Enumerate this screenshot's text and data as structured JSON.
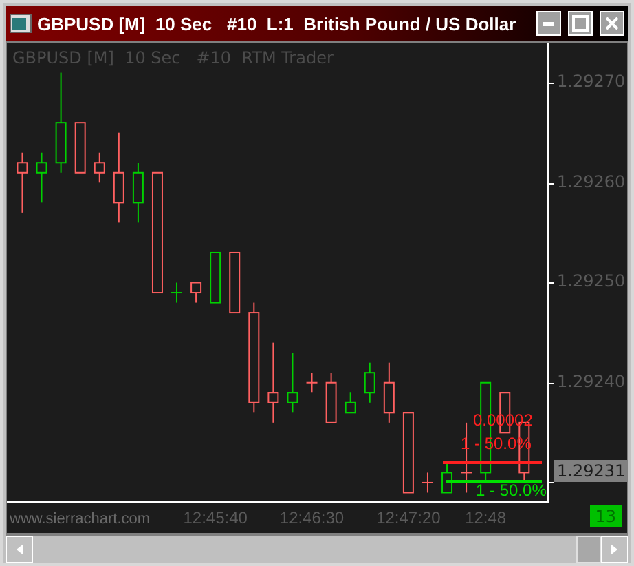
{
  "window": {
    "title": "GBPUSD [M]  10 Sec   #10  L:1  British Pound / US Dollar"
  },
  "chart": {
    "header": "GBPUSD [M]  10 Sec   #10  RTM Trader",
    "chart_data": {
      "type": "candlestick",
      "x": [
        45840,
        45850,
        45860,
        45870,
        45880,
        45890,
        45900,
        45910,
        45920,
        45930,
        45940,
        45950,
        45960,
        45970,
        45980,
        45990,
        46000,
        46010,
        46020,
        46030,
        46040,
        46050,
        46060,
        46070,
        46080,
        46090,
        46100
      ],
      "ohlc": [
        [
          1.29262,
          1.29263,
          1.29257,
          1.29261
        ],
        [
          1.29261,
          1.29263,
          1.29258,
          1.29262
        ],
        [
          1.29262,
          1.29271,
          1.29261,
          1.29266
        ],
        [
          1.29266,
          1.29266,
          1.29261,
          1.29261
        ],
        [
          1.29262,
          1.29263,
          1.2926,
          1.29261
        ],
        [
          1.29261,
          1.29265,
          1.29256,
          1.29258
        ],
        [
          1.29258,
          1.29262,
          1.29256,
          1.29261
        ],
        [
          1.29261,
          1.29261,
          1.29249,
          1.29249
        ],
        [
          1.29249,
          1.2925,
          1.29248,
          1.29249
        ],
        [
          1.2925,
          1.2925,
          1.29248,
          1.29249
        ],
        [
          1.29248,
          1.29253,
          1.29248,
          1.29253
        ],
        [
          1.29253,
          1.29253,
          1.29247,
          1.29247
        ],
        [
          1.29247,
          1.29248,
          1.29237,
          1.29238
        ],
        [
          1.29239,
          1.29244,
          1.29236,
          1.29238
        ],
        [
          1.29238,
          1.29243,
          1.29237,
          1.29239
        ],
        [
          1.2924,
          1.29241,
          1.29239,
          1.2924
        ],
        [
          1.2924,
          1.29241,
          1.29236,
          1.29236
        ],
        [
          1.29237,
          1.29239,
          1.29237,
          1.29238
        ],
        [
          1.29239,
          1.29242,
          1.29238,
          1.29241
        ],
        [
          1.2924,
          1.29242,
          1.29236,
          1.29237
        ],
        [
          1.29237,
          1.29237,
          1.29229,
          1.29229
        ],
        [
          1.2923,
          1.29231,
          1.29229,
          1.2923
        ],
        [
          1.29229,
          1.29232,
          1.29229,
          1.29231
        ],
        [
          1.29231,
          1.29236,
          1.29229,
          1.29231
        ],
        [
          1.29231,
          1.2924,
          1.2923,
          1.2924
        ],
        [
          1.29239,
          1.29239,
          1.29235,
          1.29235
        ],
        [
          1.29236,
          1.29236,
          1.2923,
          1.29231
        ]
      ],
      "xlim": [
        45832,
        46112
      ],
      "ylim": [
        1.29228,
        1.29274
      ],
      "xticks": [
        {
          "value": 45940,
          "label": "12:45:40"
        },
        {
          "value": 45990,
          "label": "12:46:30"
        },
        {
          "value": 46040,
          "label": "12:47:20"
        },
        {
          "value": 46080,
          "label": "12:48"
        }
      ],
      "yticks": [
        {
          "value": 1.2927,
          "label": "1.29270"
        },
        {
          "value": 1.2926,
          "label": "1.29260"
        },
        {
          "value": 1.2925,
          "label": "1.29250"
        },
        {
          "value": 1.2924,
          "label": "1.29240"
        }
      ]
    },
    "current_price": "1.29231",
    "overlays": [
      {
        "text": "0.00002",
        "color": "#ff2020"
      },
      {
        "text": "1 - 50.0%",
        "color": "#ff2020"
      },
      {
        "text": "1 - 50.0%",
        "color": "#00e000"
      }
    ],
    "site_text": "www.sierrachart.com",
    "bar_count": "13"
  }
}
